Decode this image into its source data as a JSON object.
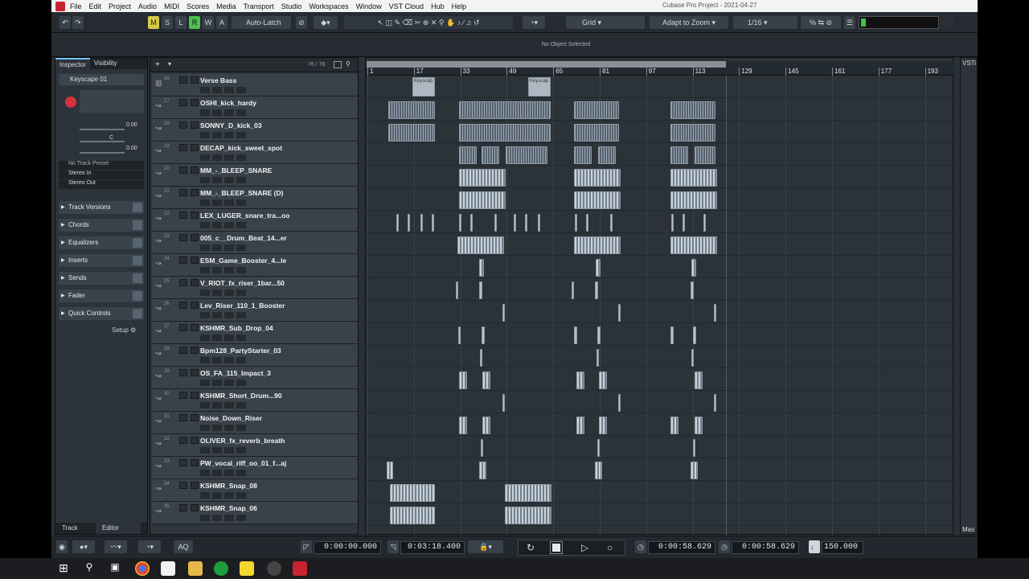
{
  "menu": {
    "items": [
      "File",
      "Edit",
      "Project",
      "Audio",
      "MIDI",
      "Scores",
      "Media",
      "Transport",
      "Studio",
      "Workspaces",
      "Window",
      "VST Cloud",
      "Hub",
      "Help"
    ],
    "window_title": "Cubase Pro Project - 2021-04-27"
  },
  "toolbar": {
    "m": "M",
    "s": "S",
    "l": "L",
    "r": "R",
    "w": "W",
    "a": "A",
    "automation_mode": "Auto-Latch",
    "snap_type": "Grid",
    "grid_quantize": "Adapt to Zoom",
    "quantize_value": "1/16"
  },
  "status": {
    "selection": "No Object Selected"
  },
  "inspector": {
    "tab_inspector": "Inspector",
    "tab_visibility": "Visibility",
    "track_name": "Keyscape 01",
    "vol": "0.00",
    "pan": "C",
    "delay": "0.00",
    "preset": "No Track Preset",
    "input": "Stereo In",
    "output": "Stereo Out",
    "sections": [
      "Track Versions",
      "Chords",
      "Equalizers",
      "Inserts",
      "Sends",
      "Fader",
      "Quick Controls"
    ],
    "setup": "Setup",
    "bottom_track": "Track",
    "bottom_editor": "Editor"
  },
  "tracklist": {
    "count": "76 / 76"
  },
  "tracks": [
    {
      "num": "16",
      "name": "Verse Bass"
    },
    {
      "num": "17",
      "name": "OSHI_kick_hardy"
    },
    {
      "num": "18",
      "name": "SONNY_D_kick_03"
    },
    {
      "num": "19",
      "name": "DECAP_kick_sweet_spot"
    },
    {
      "num": "20",
      "name": "MM_-_BLEEP_SNARE"
    },
    {
      "num": "21",
      "name": "MM_-_BLEEP_SNARE (D)"
    },
    {
      "num": "22",
      "name": "LEX_LUGER_snare_tra...oo"
    },
    {
      "num": "23",
      "name": "005_c__Drum_Beat_14...er"
    },
    {
      "num": "24",
      "name": "ESM_Game_Booster_4...le"
    },
    {
      "num": "25",
      "name": "V_RIOT_fx_riser_1bar...50"
    },
    {
      "num": "26",
      "name": "Lev_Riser_110_1_Booster"
    },
    {
      "num": "27",
      "name": "KSHMR_Sub_Drop_04"
    },
    {
      "num": "28",
      "name": "Bpm128_PartyStarter_03"
    },
    {
      "num": "29",
      "name": "OS_FA_115_Impact_3"
    },
    {
      "num": "30",
      "name": "KSHMR_Short_Drum...90"
    },
    {
      "num": "31",
      "name": "Noise_Down_Riser"
    },
    {
      "num": "32",
      "name": "OLIVER_fx_reverb_breath"
    },
    {
      "num": "33",
      "name": "PW_vocal_riff_oo_01_f...aj"
    },
    {
      "num": "34",
      "name": "KSHMR_Snap_08"
    },
    {
      "num": "35",
      "name": "KSHMR_Snap_06"
    }
  ],
  "ruler": {
    "bars": [
      "1",
      "17",
      "33",
      "49",
      "65",
      "81",
      "97",
      "113",
      "129",
      "145",
      "161",
      "177",
      "193"
    ]
  },
  "events": {
    "keyscape": "Keyscap"
  },
  "vsti": {
    "label": "VSTi",
    "mas": "Mas"
  },
  "transport": {
    "aq": "AQ",
    "left_locator": "0:00:00.000",
    "right_locator": "0:03:18.400",
    "primary_time": "0:00:58.629",
    "secondary_time": "0:00:58.629",
    "tempo": "150.000"
  }
}
